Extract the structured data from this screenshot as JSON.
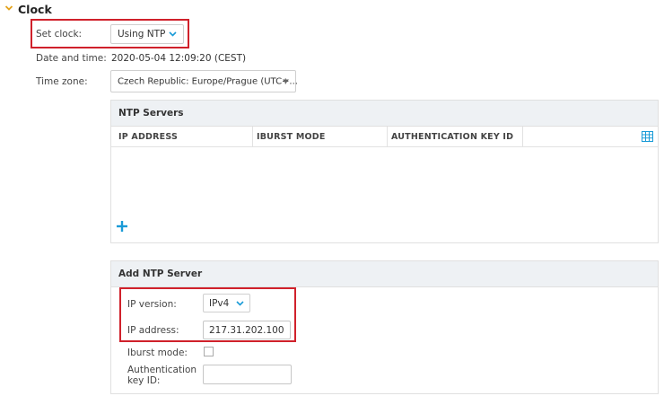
{
  "section": {
    "title": "Clock"
  },
  "set_clock": {
    "label": "Set clock:",
    "value": "Using NTP"
  },
  "date_time": {
    "label": "Date and time:",
    "value": "2020-05-04 12:09:20 (CEST)"
  },
  "time_zone": {
    "label": "Time zone:",
    "value": "Czech Republic: Europe/Prague (UTC+..."
  },
  "ntp_servers": {
    "title": "NTP Servers",
    "columns": [
      "IP ADDRESS",
      "IBURST MODE",
      "AUTHENTICATION KEY ID"
    ],
    "add_symbol": "+"
  },
  "add_ntp": {
    "title": "Add NTP Server",
    "ip_version": {
      "label": "IP version:",
      "value": "IPv4"
    },
    "ip_address": {
      "label": "IP address:",
      "value": "217.31.202.100"
    },
    "iburst": {
      "label": "Iburst mode:",
      "checked": false
    },
    "auth_key": {
      "label_line1": "Authentication",
      "label_line2": "key ID:",
      "value": ""
    }
  },
  "colors": {
    "accent": "#1a9bd7",
    "highlight": "#d0212b",
    "chevron": "#e3a21a"
  }
}
